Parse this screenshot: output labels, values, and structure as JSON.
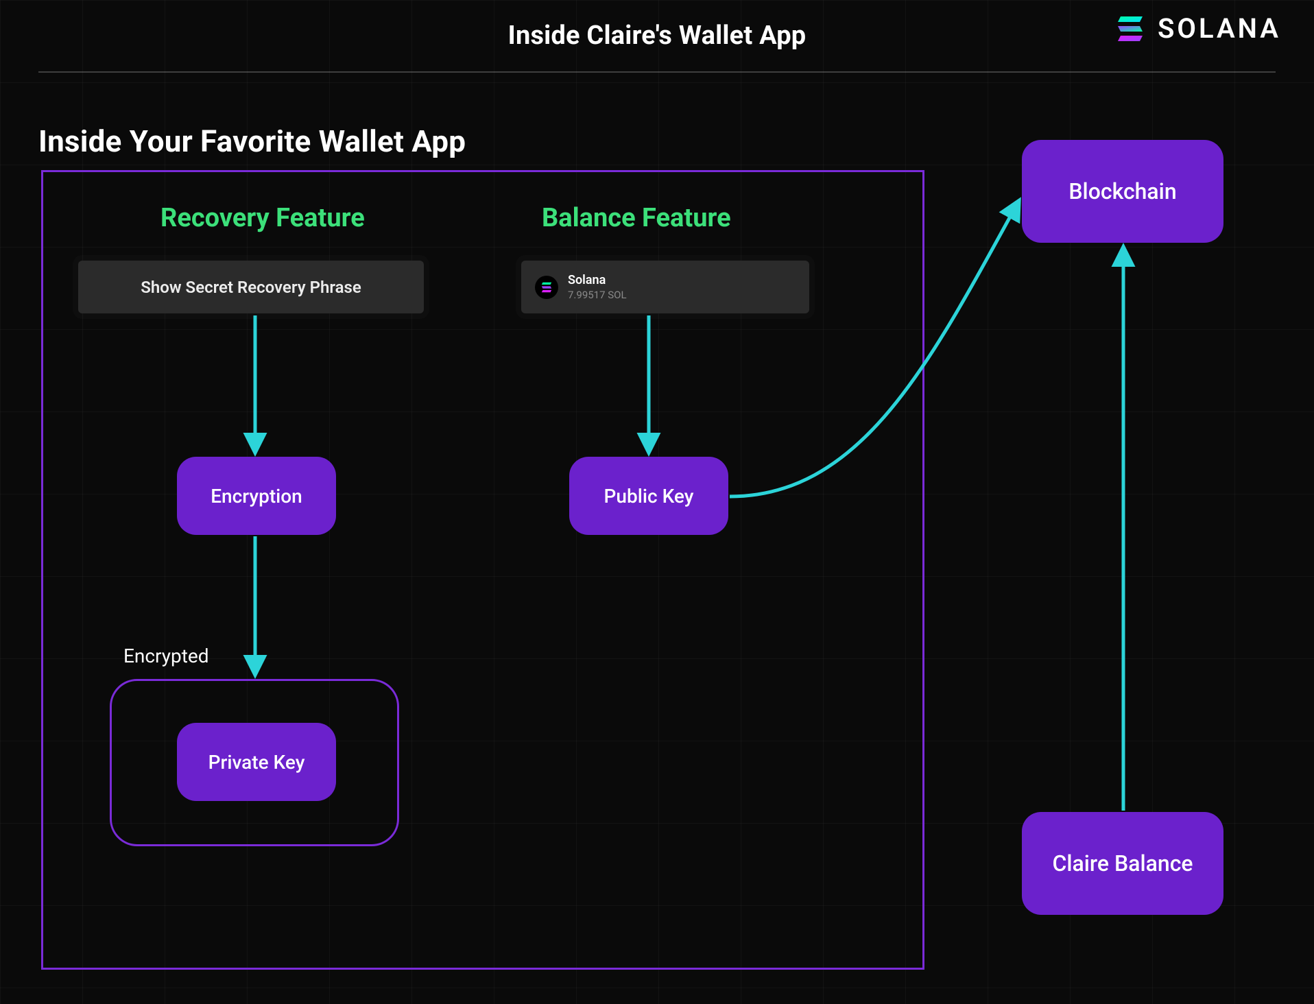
{
  "header": {
    "title": "Inside Claire's Wallet App",
    "brand_word": "SOLANA"
  },
  "section_title": "Inside Your Favorite Wallet App",
  "features": {
    "recovery_title": "Recovery Feature",
    "balance_title": "Balance Feature"
  },
  "recovery_card": {
    "label": "Show Secret Recovery Phrase"
  },
  "balance_card": {
    "coin_name": "Solana",
    "coin_amount": "7.99517 SOL"
  },
  "nodes": {
    "encryption": "Encryption",
    "public_key": "Public Key",
    "private_key": "Private Key",
    "blockchain": "Blockchain",
    "claire_balance": "Claire Balance"
  },
  "encrypted_label": "Encrypted",
  "colors": {
    "arrow": "#2CD4D9",
    "node": "#6B21CC",
    "border": "#7A2BD8",
    "feature_title": "#3CE07A"
  }
}
